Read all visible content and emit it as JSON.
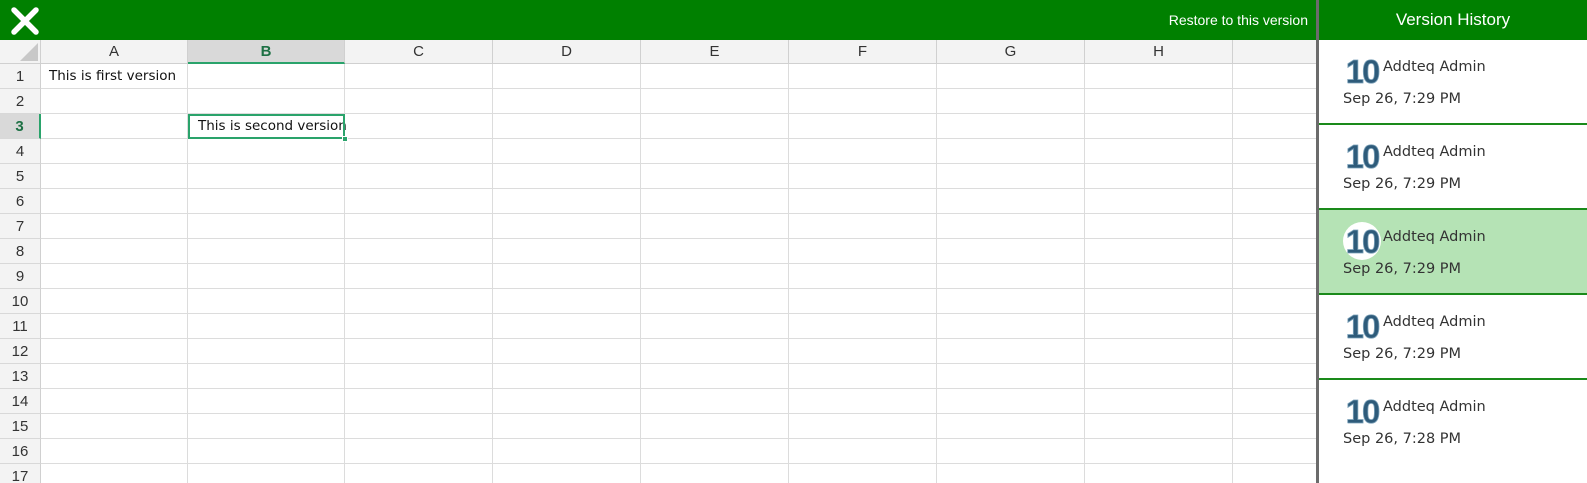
{
  "toolbar": {
    "close_icon": "close-icon",
    "restore_label": "Restore to this version"
  },
  "version_panel": {
    "title": "Version History",
    "items": [
      {
        "user": "Addteq Admin",
        "date": "Sep 26, 7:29 PM",
        "avatar_text": "10",
        "selected": false
      },
      {
        "user": "Addteq Admin",
        "date": "Sep 26, 7:29 PM",
        "avatar_text": "10",
        "selected": false
      },
      {
        "user": "Addteq Admin",
        "date": "Sep 26, 7:29 PM",
        "avatar_text": "10",
        "selected": true
      },
      {
        "user": "Addteq Admin",
        "date": "Sep 26, 7:29 PM",
        "avatar_text": "10",
        "selected": false
      },
      {
        "user": "Addteq Admin",
        "date": "Sep 26, 7:28 PM",
        "avatar_text": "10",
        "selected": false
      }
    ]
  },
  "sheet": {
    "columns": [
      "A",
      "B",
      "C",
      "D",
      "E",
      "F",
      "G",
      "H",
      ""
    ],
    "rows": [
      "1",
      "2",
      "3",
      "4",
      "5",
      "6",
      "7",
      "8",
      "9",
      "10",
      "11",
      "12",
      "13",
      "14",
      "15",
      "16",
      "17"
    ],
    "active_column": "B",
    "active_row": "3",
    "cells": {
      "A1": "This is first version",
      "B3": "This is second version"
    }
  },
  "colors": {
    "accent": "#008000",
    "selection": "#2aa36b",
    "selected_version_bg": "#b5e3b5"
  }
}
